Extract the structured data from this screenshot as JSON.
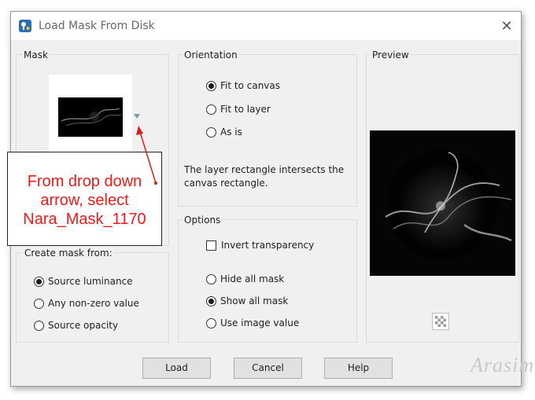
{
  "window": {
    "title": "Load Mask From Disk",
    "close_glyph": "✕",
    "app_icon": "paintshop-pro-icon"
  },
  "mask_group": {
    "label": "Mask",
    "dropdown_icon": "chevron-down-icon",
    "thumbnail": "mask-thumbnail"
  },
  "create_mask_group": {
    "label": "Create mask from:",
    "options": [
      {
        "label": "Source luminance",
        "selected": true
      },
      {
        "label": "Any non-zero value",
        "selected": false
      },
      {
        "label": "Source opacity",
        "selected": false
      }
    ]
  },
  "orientation_group": {
    "label": "Orientation",
    "options": [
      {
        "label": "Fit to canvas",
        "selected": true
      },
      {
        "label": "Fit to layer",
        "selected": false
      },
      {
        "label": "As is",
        "selected": false
      }
    ],
    "info_line1": "The layer rectangle intersects the",
    "info_line2": "canvas rectangle."
  },
  "options_group": {
    "label": "Options",
    "invert_transparency": {
      "label": "Invert transparency",
      "checked": false
    },
    "mask_options": [
      {
        "label": "Hide all mask",
        "selected": false
      },
      {
        "label": "Show all mask",
        "selected": true
      },
      {
        "label": "Use image value",
        "selected": false
      }
    ]
  },
  "preview_group": {
    "label": "Preview",
    "toggle_icon": "checkerboard-icon"
  },
  "buttons": {
    "load": "Load",
    "cancel": "Cancel",
    "help": "Help"
  },
  "annotation": {
    "line1": "From drop down",
    "line2": "arrow, select",
    "line3": "Nara_Mask_1170"
  },
  "watermark": "Arasim",
  "colors": {
    "dialog_bg": "#f0f0f0",
    "annotation_text": "#ee1a1a",
    "arrow": "#d61f1f",
    "preview_bg": "#000000"
  }
}
